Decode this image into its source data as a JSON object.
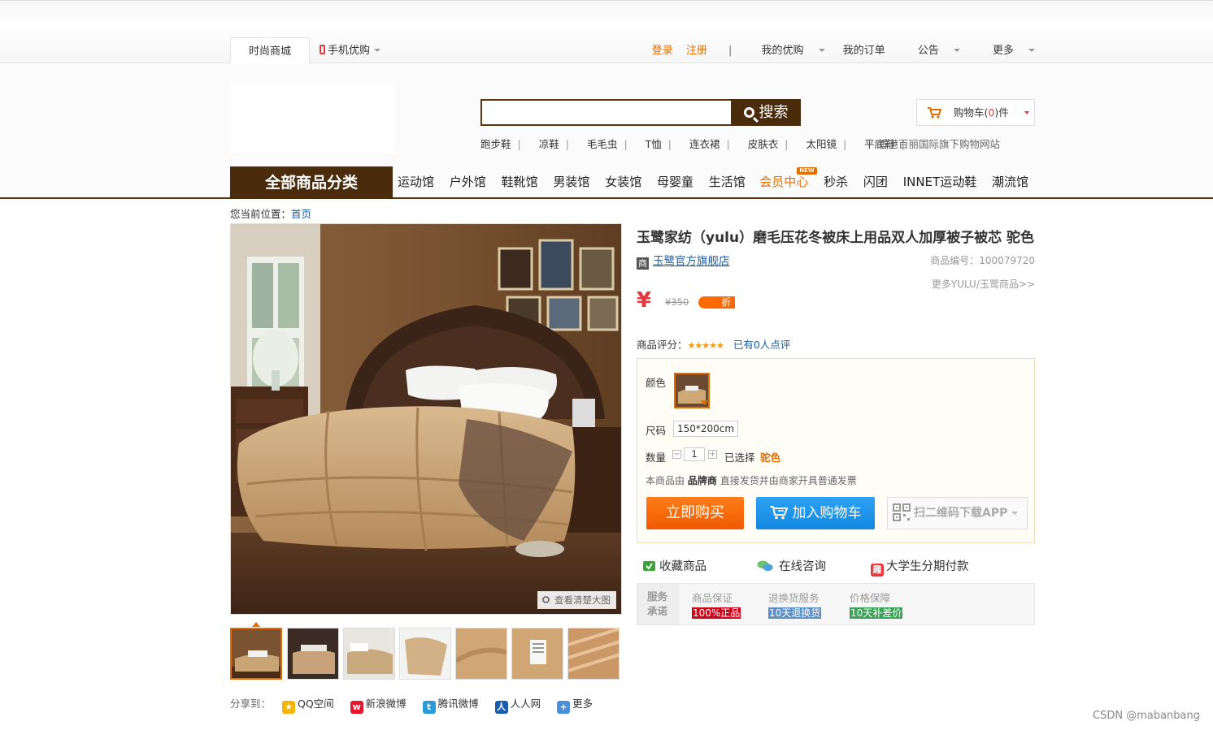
{
  "topbar": {
    "tab_mall": "时尚商城",
    "mobile_label": "手机优购",
    "login": "登录",
    "register": "注册",
    "separator": "|",
    "my_yougou": "我的优购",
    "my_orders": "我的订单",
    "announcement": "公告",
    "more": "更多"
  },
  "search": {
    "placeholder": "",
    "button_label": "搜索"
  },
  "hotwords": [
    "跑步鞋",
    "凉鞋",
    "毛毛虫",
    "T恤",
    "连衣裙",
    "皮肤衣",
    "太阳镜",
    "平底鞋",
    "香港"
  ],
  "hotword_separator": "|",
  "slogan": "百丽国际旗下购物网站",
  "cart": {
    "label_prefix": "购物车(",
    "count": "0",
    "label_suffix": ")件"
  },
  "catnav": {
    "all": "全部商品分类",
    "left": [
      "运动馆",
      "户外馆",
      "鞋靴馆",
      "男装馆",
      "女装馆",
      "母婴童",
      "生活馆"
    ],
    "member": "会员中心",
    "new_badge": "NEW",
    "right": [
      "秒杀",
      "闪团",
      "INNET运动鞋",
      "潮流馆"
    ]
  },
  "breadcrumb": {
    "prefix": "您当前位置：",
    "home": "首页"
  },
  "gallery": {
    "zoom_hint": "查看清楚大图",
    "thumb_count": 7
  },
  "share": {
    "label": "分享到：",
    "items": [
      "QQ空间",
      "新浪微博",
      "腾讯微博",
      "人人网",
      "更多"
    ]
  },
  "product": {
    "title": "玉鹭家纺（yulu）磨毛压花冬被床上用品双人加厚被子被芯 驼色",
    "store_icon": "商",
    "store": "玉鹭官方旗舰店",
    "id_label": "商品编号：",
    "id": "100079720",
    "more_brand": "更多YULU/玉鹭商品>>",
    "currency": "¥",
    "old_price": "¥350",
    "discount_label": "折",
    "rating_label": "商品评分：",
    "stars": "★★★★★",
    "review_count": "已有0人点评"
  },
  "choose": {
    "color_label": "颜色",
    "size_label": "尺码",
    "size_value": "150*200cm",
    "qty_label": "数量",
    "qty_minus": "−",
    "qty_value": "1",
    "qty_plus": "+",
    "selected_label": "已选择",
    "selected_value": "驼色",
    "notice_prefix": "本商品由",
    "notice_brand": "品牌商",
    "notice_suffix": "直接发货并由商家开具普通发票",
    "buy_now": "立即购买",
    "add_cart": "加入购物车",
    "qr_download": "扫二维码下载APP"
  },
  "actions": {
    "favorite": "收藏商品",
    "consult": "在线咨询",
    "installment_icon": "趣",
    "installment": "大学生分期付款"
  },
  "promise": {
    "label_line1": "服务",
    "label_line2": "承诺",
    "items": [
      {
        "title": "商品保证",
        "tag": "100%正品",
        "color": "#d0021b"
      },
      {
        "title": "退换货服务",
        "tag": "10天退换货",
        "color": "#5b8fc7"
      },
      {
        "title": "价格保障",
        "tag": "10天补差价",
        "color": "#3aa356"
      }
    ]
  },
  "watermark": "CSDN @mabanbang",
  "colors": {
    "brand_brown": "#4a2c0d",
    "accent_orange": "#e56c00",
    "link_blue": "#1a5c9f",
    "price_red": "#e4393c"
  }
}
